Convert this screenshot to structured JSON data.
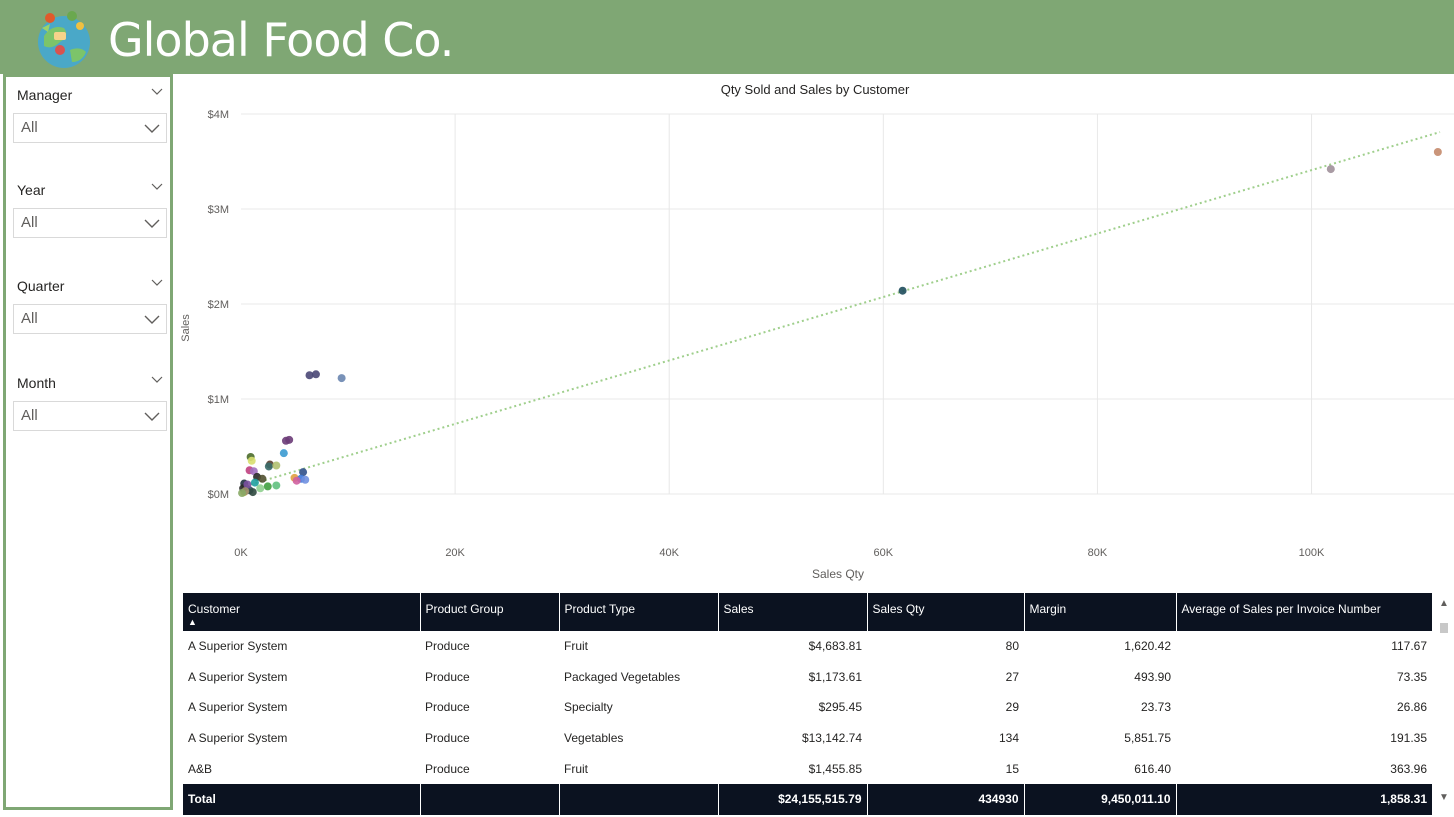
{
  "header": {
    "title": "Global Food Co.",
    "brand_color": "#7fa774"
  },
  "filters": [
    {
      "label": "Manager",
      "value": "All"
    },
    {
      "label": "Year",
      "value": "All"
    },
    {
      "label": "Quarter",
      "value": "All"
    },
    {
      "label": "Month",
      "value": "All"
    }
  ],
  "chart_data": {
    "type": "scatter",
    "title": "Qty Sold and Sales by Customer",
    "xlabel": "Sales Qty",
    "ylabel": "Sales",
    "xlim": [
      0,
      112000
    ],
    "ylim": [
      0,
      4000000
    ],
    "x_ticks": [
      0,
      20000,
      40000,
      60000,
      80000,
      100000
    ],
    "x_tick_labels": [
      "0K",
      "20K",
      "40K",
      "60K",
      "80K",
      "100K"
    ],
    "y_ticks": [
      0,
      1000000,
      2000000,
      3000000,
      4000000
    ],
    "y_tick_labels": [
      "$0M",
      "$1M",
      "$2M",
      "$3M",
      "$4M"
    ],
    "grid": true,
    "trendline": {
      "style": "dotted",
      "color": "#9fcf8c",
      "from": [
        0,
        70000
      ],
      "to": [
        112000,
        3810000
      ]
    },
    "points": [
      {
        "x": 111800,
        "y": 3600000,
        "color": "#c48a6b"
      },
      {
        "x": 101800,
        "y": 3420000,
        "color": "#a0909a"
      },
      {
        "x": 61800,
        "y": 2140000,
        "color": "#1e4d5c"
      },
      {
        "x": 6400,
        "y": 1250000,
        "color": "#4a4775"
      },
      {
        "x": 7000,
        "y": 1260000,
        "color": "#4a4775"
      },
      {
        "x": 9400,
        "y": 1220000,
        "color": "#6a86b0"
      },
      {
        "x": 4200,
        "y": 560000,
        "color": "#6b3c78"
      },
      {
        "x": 4500,
        "y": 570000,
        "color": "#6b3c78"
      },
      {
        "x": 4000,
        "y": 430000,
        "color": "#3b9ad0"
      },
      {
        "x": 900,
        "y": 390000,
        "color": "#4a6b2a"
      },
      {
        "x": 1000,
        "y": 350000,
        "color": "#d8e070"
      },
      {
        "x": 2700,
        "y": 310000,
        "color": "#5a4030"
      },
      {
        "x": 2600,
        "y": 290000,
        "color": "#3a6b6a"
      },
      {
        "x": 3300,
        "y": 300000,
        "color": "#b0c070"
      },
      {
        "x": 800,
        "y": 250000,
        "color": "#c04080"
      },
      {
        "x": 1200,
        "y": 240000,
        "color": "#a070c0"
      },
      {
        "x": 5800,
        "y": 230000,
        "color": "#30508a"
      },
      {
        "x": 1500,
        "y": 180000,
        "color": "#282828"
      },
      {
        "x": 2000,
        "y": 160000,
        "color": "#505030"
      },
      {
        "x": 5000,
        "y": 170000,
        "color": "#e0a040"
      },
      {
        "x": 5600,
        "y": 160000,
        "color": "#3c78d8"
      },
      {
        "x": 6000,
        "y": 150000,
        "color": "#7090e0"
      },
      {
        "x": 5200,
        "y": 140000,
        "color": "#d060a0"
      },
      {
        "x": 3300,
        "y": 90000,
        "color": "#60c080"
      },
      {
        "x": 2500,
        "y": 80000,
        "color": "#40a040"
      },
      {
        "x": 1800,
        "y": 60000,
        "color": "#90d090"
      },
      {
        "x": 300,
        "y": 110000,
        "color": "#203040"
      },
      {
        "x": 500,
        "y": 60000,
        "color": "#607030"
      },
      {
        "x": 800,
        "y": 40000,
        "color": "#3a5060"
      },
      {
        "x": 1100,
        "y": 20000,
        "color": "#304a40"
      },
      {
        "x": 300,
        "y": 20000,
        "color": "#c0b040"
      },
      {
        "x": 200,
        "y": 60000,
        "color": "#2a2a2a"
      },
      {
        "x": 600,
        "y": 100000,
        "color": "#7a50a0"
      },
      {
        "x": 1300,
        "y": 120000,
        "color": "#20a0a0"
      },
      {
        "x": 400,
        "y": 30000,
        "color": "#a09070"
      },
      {
        "x": 100,
        "y": 10000,
        "color": "#88aa66"
      }
    ]
  },
  "table": {
    "columns": [
      "Customer",
      "Product Group",
      "Product Type",
      "Sales",
      "Sales Qty",
      "Margin",
      "Average of Sales per Invoice Number"
    ],
    "sort_indicator": "▲",
    "rows": [
      [
        "A Superior System",
        "Produce",
        "Fruit",
        "$4,683.81",
        "80",
        "1,620.42",
        "117.67"
      ],
      [
        "A Superior System",
        "Produce",
        "Packaged Vegetables",
        "$1,173.61",
        "27",
        "493.90",
        "73.35"
      ],
      [
        "A Superior System",
        "Produce",
        "Specialty",
        "$295.45",
        "29",
        "23.73",
        "26.86"
      ],
      [
        "A Superior System",
        "Produce",
        "Vegetables",
        "$13,142.74",
        "134",
        "5,851.75",
        "191.35"
      ],
      [
        "A&B",
        "Produce",
        "Fruit",
        "$1,455.85",
        "15",
        "616.40",
        "363.96"
      ]
    ],
    "total": [
      "Total",
      "",
      "",
      "$24,155,515.79",
      "434930",
      "9,450,011.10",
      "1,858.31"
    ]
  }
}
